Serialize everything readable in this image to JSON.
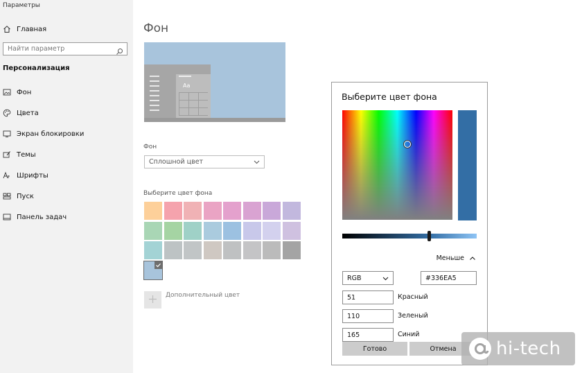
{
  "window": {
    "title": "Параметры"
  },
  "sidebar": {
    "home_label": "Главная",
    "search_placeholder": "Найти параметр",
    "section_title": "Персонализация",
    "items": [
      {
        "label": "Фон",
        "icon": "picture-icon"
      },
      {
        "label": "Цвета",
        "icon": "palette-icon"
      },
      {
        "label": "Экран блокировки",
        "icon": "monitor-icon"
      },
      {
        "label": "Темы",
        "icon": "brush-icon"
      },
      {
        "label": "Шрифты",
        "icon": "font-icon"
      },
      {
        "label": "Пуск",
        "icon": "start-icon"
      },
      {
        "label": "Панель задач",
        "icon": "taskbar-icon"
      }
    ]
  },
  "main": {
    "title": "Фон",
    "preview": {
      "sample_text": "Aa",
      "color": "#a8c4dc"
    },
    "background_label": "Фон",
    "background_select_value": "Сплошной цвет",
    "swatches_label": "Выберите цвет фона",
    "swatches": [
      "#fdd09a",
      "#f5a3ad",
      "#f0b2b5",
      "#eaa4c4",
      "#e4a1cd",
      "#d9a3d2",
      "#c9a8d9",
      "#c2b8de",
      "#a9d6b5",
      "#a5d4a3",
      "#9fd1c7",
      "#aacbde",
      "#9cc1e1",
      "#c8c8ea",
      "#d3d1ee",
      "#cfc1e0",
      "#a3d3d5",
      "#bdc3c4",
      "#c1c5c6",
      "#cfc8c2",
      "#bfc1c2",
      "#c4c4c6",
      "#bbbbbb",
      "#a4a4a4",
      "#a8c4dc"
    ],
    "selected_swatch": 24,
    "custom_color_label": "Дополнительный цвет"
  },
  "dialog": {
    "title": "Выберите цвет фона",
    "current_color": "#336EA5",
    "less_label": "Меньше",
    "mode_value": "RGB",
    "hex_value": "#336EA5",
    "red_value": "51",
    "red_label": "Красный",
    "green_value": "110",
    "green_label": "Зеленый",
    "blue_value": "165",
    "blue_label": "Синий",
    "done_label": "Готово",
    "cancel_label": "Отмена"
  },
  "watermark": {
    "text": "hi-tech"
  }
}
